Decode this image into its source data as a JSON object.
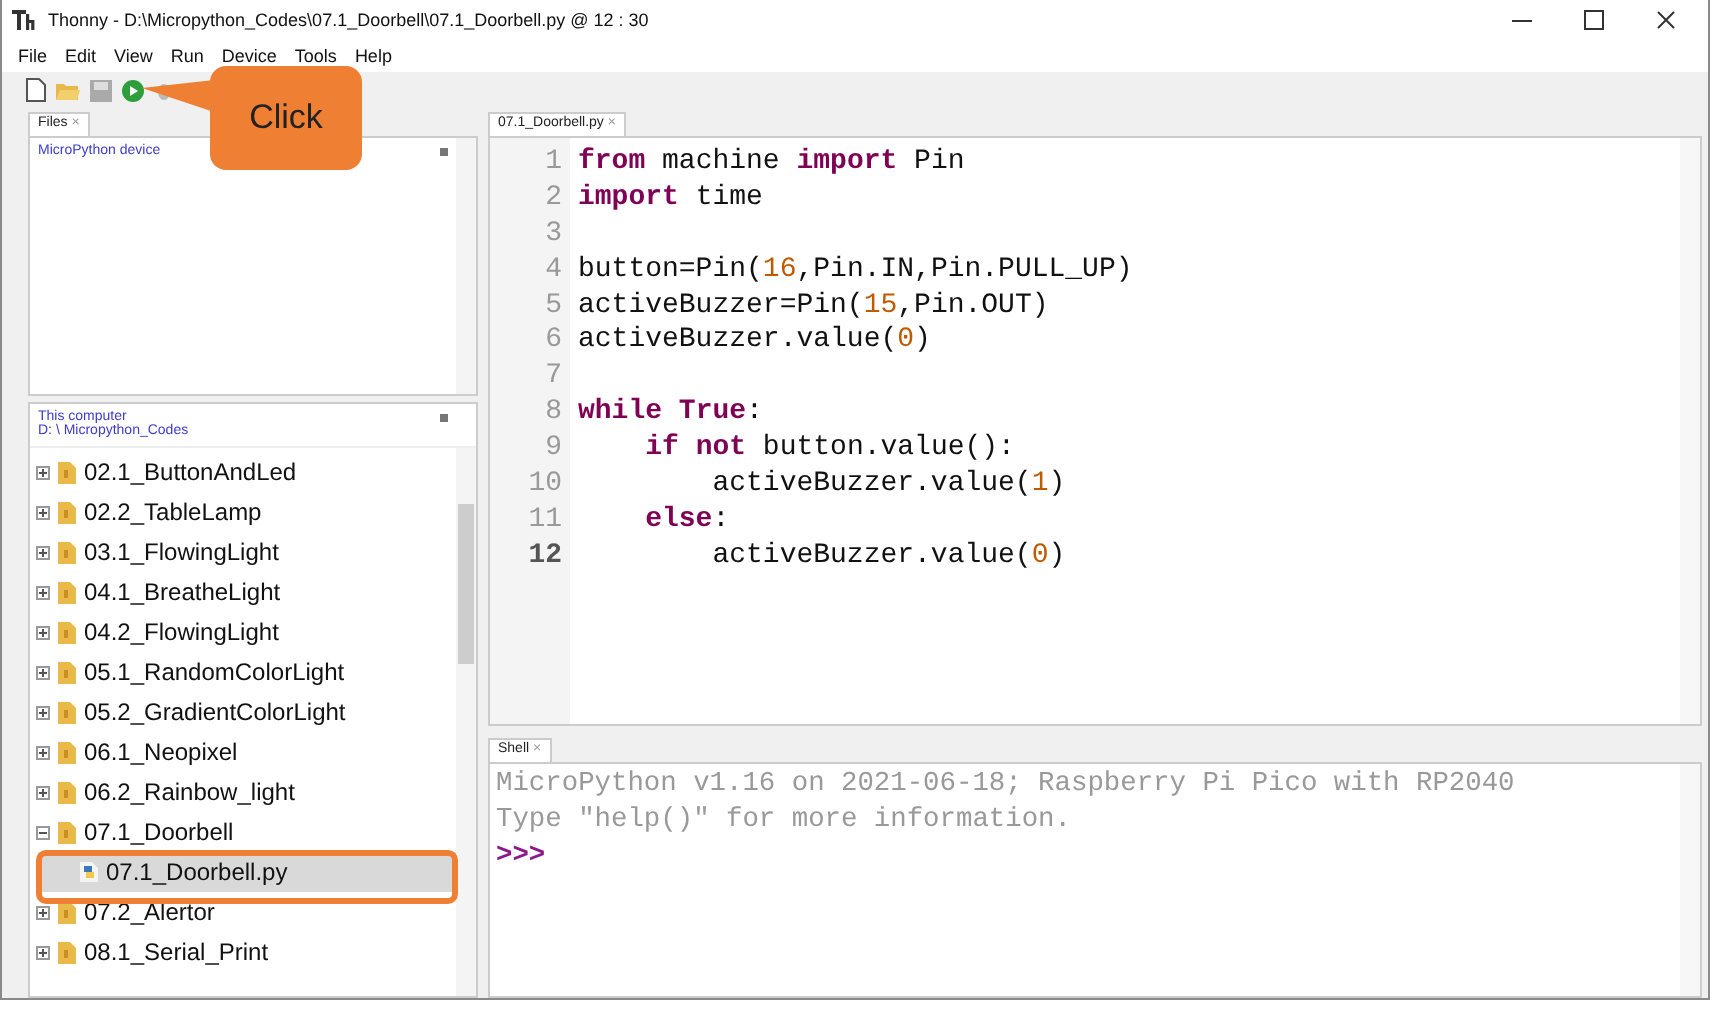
{
  "window": {
    "title": "Thonny  -  D:\\Micropython_Codes\\07.1_Doorbell\\07.1_Doorbell.py  @  12 : 30"
  },
  "menu": [
    "File",
    "Edit",
    "View",
    "Run",
    "Device",
    "Tools",
    "Help"
  ],
  "callout": {
    "text": "Click"
  },
  "files_tab": {
    "label": "Files",
    "close": "×"
  },
  "device_panel": {
    "title": "MicroPython device"
  },
  "computer_panel": {
    "title": "This computer",
    "path": "D: \\ Micropython_Codes"
  },
  "tree": [
    {
      "name": "02.1_ButtonAndLed",
      "kind": "folder",
      "expanded": false,
      "selected": false
    },
    {
      "name": "02.2_TableLamp",
      "kind": "folder",
      "expanded": false,
      "selected": false
    },
    {
      "name": "03.1_FlowingLight",
      "kind": "folder",
      "expanded": false,
      "selected": false
    },
    {
      "name": "04.1_BreatheLight",
      "kind": "folder",
      "expanded": false,
      "selected": false
    },
    {
      "name": "04.2_FlowingLight",
      "kind": "folder",
      "expanded": false,
      "selected": false
    },
    {
      "name": "05.1_RandomColorLight",
      "kind": "folder",
      "expanded": false,
      "selected": false
    },
    {
      "name": "05.2_GradientColorLight",
      "kind": "folder",
      "expanded": false,
      "selected": false
    },
    {
      "name": "06.1_Neopixel",
      "kind": "folder",
      "expanded": false,
      "selected": false
    },
    {
      "name": "06.2_Rainbow_light",
      "kind": "folder",
      "expanded": false,
      "selected": false
    },
    {
      "name": "07.1_Doorbell",
      "kind": "folder",
      "expanded": true,
      "selected": false,
      "children": [
        {
          "name": "07.1_Doorbell.py",
          "kind": "file",
          "selected": true
        }
      ]
    },
    {
      "name": "07.2_Alertor",
      "kind": "folder",
      "expanded": false,
      "selected": false
    },
    {
      "name": "08.1_Serial_Print",
      "kind": "folder",
      "expanded": false,
      "selected": false
    }
  ],
  "editor_tab": {
    "label": "07.1_Doorbell.py",
    "close": "×"
  },
  "code": [
    {
      "number": "1",
      "current": false,
      "tokens": [
        {
          "text": "from",
          "kind": "keyword"
        },
        {
          "text": " machine ",
          "kind": "plain"
        },
        {
          "text": "import",
          "kind": "keyword"
        },
        {
          "text": " Pin",
          "kind": "plain"
        }
      ]
    },
    {
      "number": "2",
      "current": false,
      "tokens": [
        {
          "text": "import",
          "kind": "keyword"
        },
        {
          "text": " time",
          "kind": "plain"
        }
      ]
    },
    {
      "number": "3",
      "current": false
    },
    {
      "number": "4",
      "current": false,
      "tokens": [
        {
          "text": "button=Pin(",
          "kind": "plain"
        },
        {
          "text": "16",
          "kind": "number"
        },
        {
          "text": ",Pin.IN,Pin.PULL_UP)",
          "kind": "plain"
        }
      ]
    },
    {
      "number": "5",
      "current": false,
      "tokens": [
        {
          "text": "activeBuzzer=Pin(",
          "kind": "plain"
        },
        {
          "text": "15",
          "kind": "number"
        },
        {
          "text": ",Pin.OUT)",
          "kind": "plain"
        }
      ]
    },
    {
      "number": "6",
      "current": false,
      "tokens": [
        {
          "text": "activeBuzzer.value(",
          "kind": "plain"
        },
        {
          "text": "0",
          "kind": "number"
        },
        {
          "text": ")",
          "kind": "plain"
        }
      ]
    },
    {
      "number": "7",
      "current": false
    },
    {
      "number": "8",
      "current": false,
      "tokens": [
        {
          "text": "while",
          "kind": "keyword"
        },
        {
          "text": " True",
          "kind": "keyword"
        },
        {
          "text": ":",
          "kind": "plain"
        }
      ]
    },
    {
      "number": "9",
      "current": false,
      "tokens": [
        {
          "text": "    if",
          "kind": "keyword"
        },
        {
          "text": " not",
          "kind": "keyword"
        },
        {
          "text": " button.value():",
          "kind": "plain"
        }
      ]
    },
    {
      "number": "10",
      "current": false,
      "tokens": [
        {
          "text": "        activeBuzzer.value(",
          "kind": "plain"
        },
        {
          "text": "1",
          "kind": "number"
        },
        {
          "text": ")",
          "kind": "plain"
        }
      ]
    },
    {
      "number": "11",
      "current": false,
      "tokens": [
        {
          "text": "    else",
          "kind": "keyword"
        },
        {
          "text": ":",
          "kind": "plain"
        }
      ]
    },
    {
      "number": "12",
      "current": true,
      "tokens": [
        {
          "text": "        activeBuzzer.value(",
          "kind": "plain"
        },
        {
          "text": "0",
          "kind": "number"
        },
        {
          "text": ")",
          "kind": "plain"
        }
      ]
    }
  ],
  "shell_tab": {
    "label": "Shell",
    "close": "×"
  },
  "shell": [
    {
      "text": "MicroPython v1.16 on 2021-06-18; Raspberry Pi Pico with RP2040",
      "kind": "output"
    },
    {
      "text": "Type \"help()\" for more information.",
      "kind": "output"
    },
    {
      "text": ">>>",
      "kind": "prompt"
    }
  ]
}
